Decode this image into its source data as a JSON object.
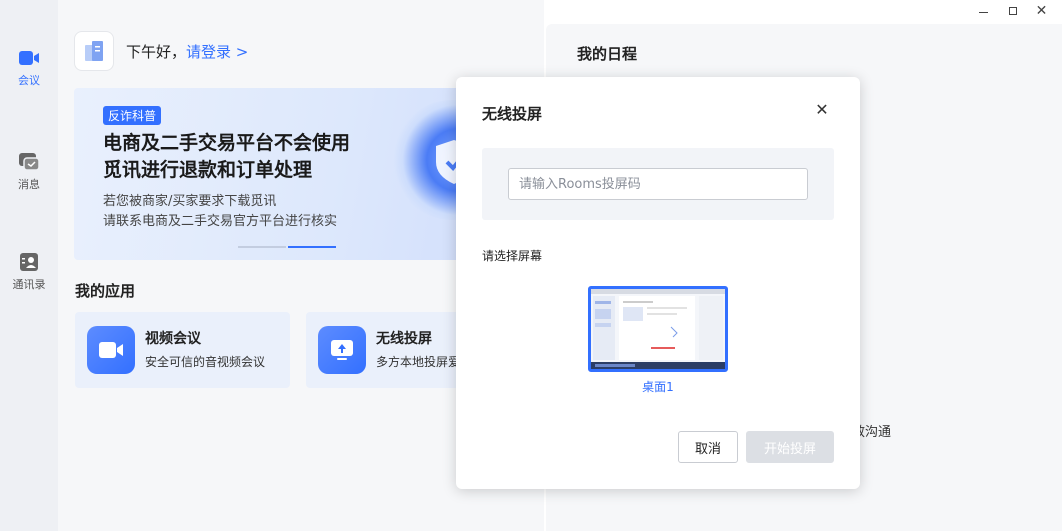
{
  "window": {
    "minimize": "minimize",
    "maximize": "maximize",
    "close": "close"
  },
  "sidebar": {
    "items": [
      {
        "label": "会议",
        "icon": "video-camera-icon",
        "active": true
      },
      {
        "label": "消息",
        "icon": "chat-bubble-icon",
        "active": false
      },
      {
        "label": "通讯录",
        "icon": "contacts-icon",
        "active": false
      }
    ]
  },
  "header": {
    "greeting": "下午好，",
    "login": "请登录 >"
  },
  "banner": {
    "tag": "反诈科普",
    "title_line1": "电商及二手交易平台不会使用",
    "title_line2": "觅讯进行退款和订单处理",
    "sub_line1": "若您被商家/买家要求下载觅讯",
    "sub_line2": "请联系电商及二手交易官方平台进行核实",
    "carousel": {
      "count": 2,
      "active": 2
    }
  },
  "apps": {
    "title": "我的应用",
    "items": [
      {
        "title": "视频会议",
        "desc": "安全可信的音视频会议"
      },
      {
        "title": "无线投屏",
        "desc": "多方本地投屏爱"
      }
    ]
  },
  "schedule": {
    "title": "我的日程",
    "hint": "效沟通"
  },
  "dialog": {
    "title": "无线投屏",
    "input_placeholder": "请输入Rooms投屏码",
    "input_value": "",
    "select_label": "请选择屏幕",
    "screens": [
      {
        "name": "桌面1",
        "selected": true
      }
    ],
    "cancel": "取消",
    "start": "开始投屏"
  },
  "colors": {
    "accent": "#3370ff",
    "sidebar_bg": "#eef0f4",
    "panel_bg": "#f6f7f9",
    "disabled": "#dcdfe4"
  }
}
